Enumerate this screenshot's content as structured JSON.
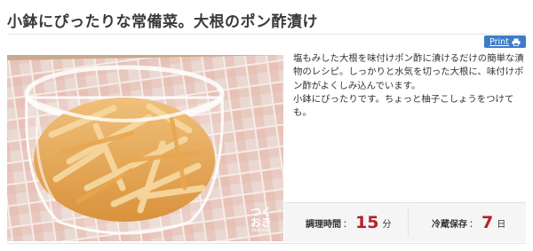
{
  "title": "小鉢にぴったりな常備菜。大根のポン酢漬け",
  "print": {
    "label": "Print",
    "icon": "printer-icon"
  },
  "photo": {
    "description_icon": "food-photo",
    "watermark_main": "つくおき",
    "watermark_sub": "tsukuoki"
  },
  "description": "塩もみした大根を味付けポン酢に漬けるだけの簡単な漬物のレシピ。しっかりと水気を切った大根に、味付けポン酢がよくしみ込んでいます。\n小鉢にぴったりです。ちょっと柚子こしょうをつけても。",
  "stats": {
    "cook_time": {
      "label": "調理時間",
      "colon": "：",
      "value": "15",
      "unit": "分"
    },
    "fridge": {
      "label": "冷蔵保存",
      "colon": "：",
      "value": "7",
      "unit": "日"
    }
  },
  "colors": {
    "accent_red": "#b5212b",
    "print_blue": "#3d7cc9"
  }
}
